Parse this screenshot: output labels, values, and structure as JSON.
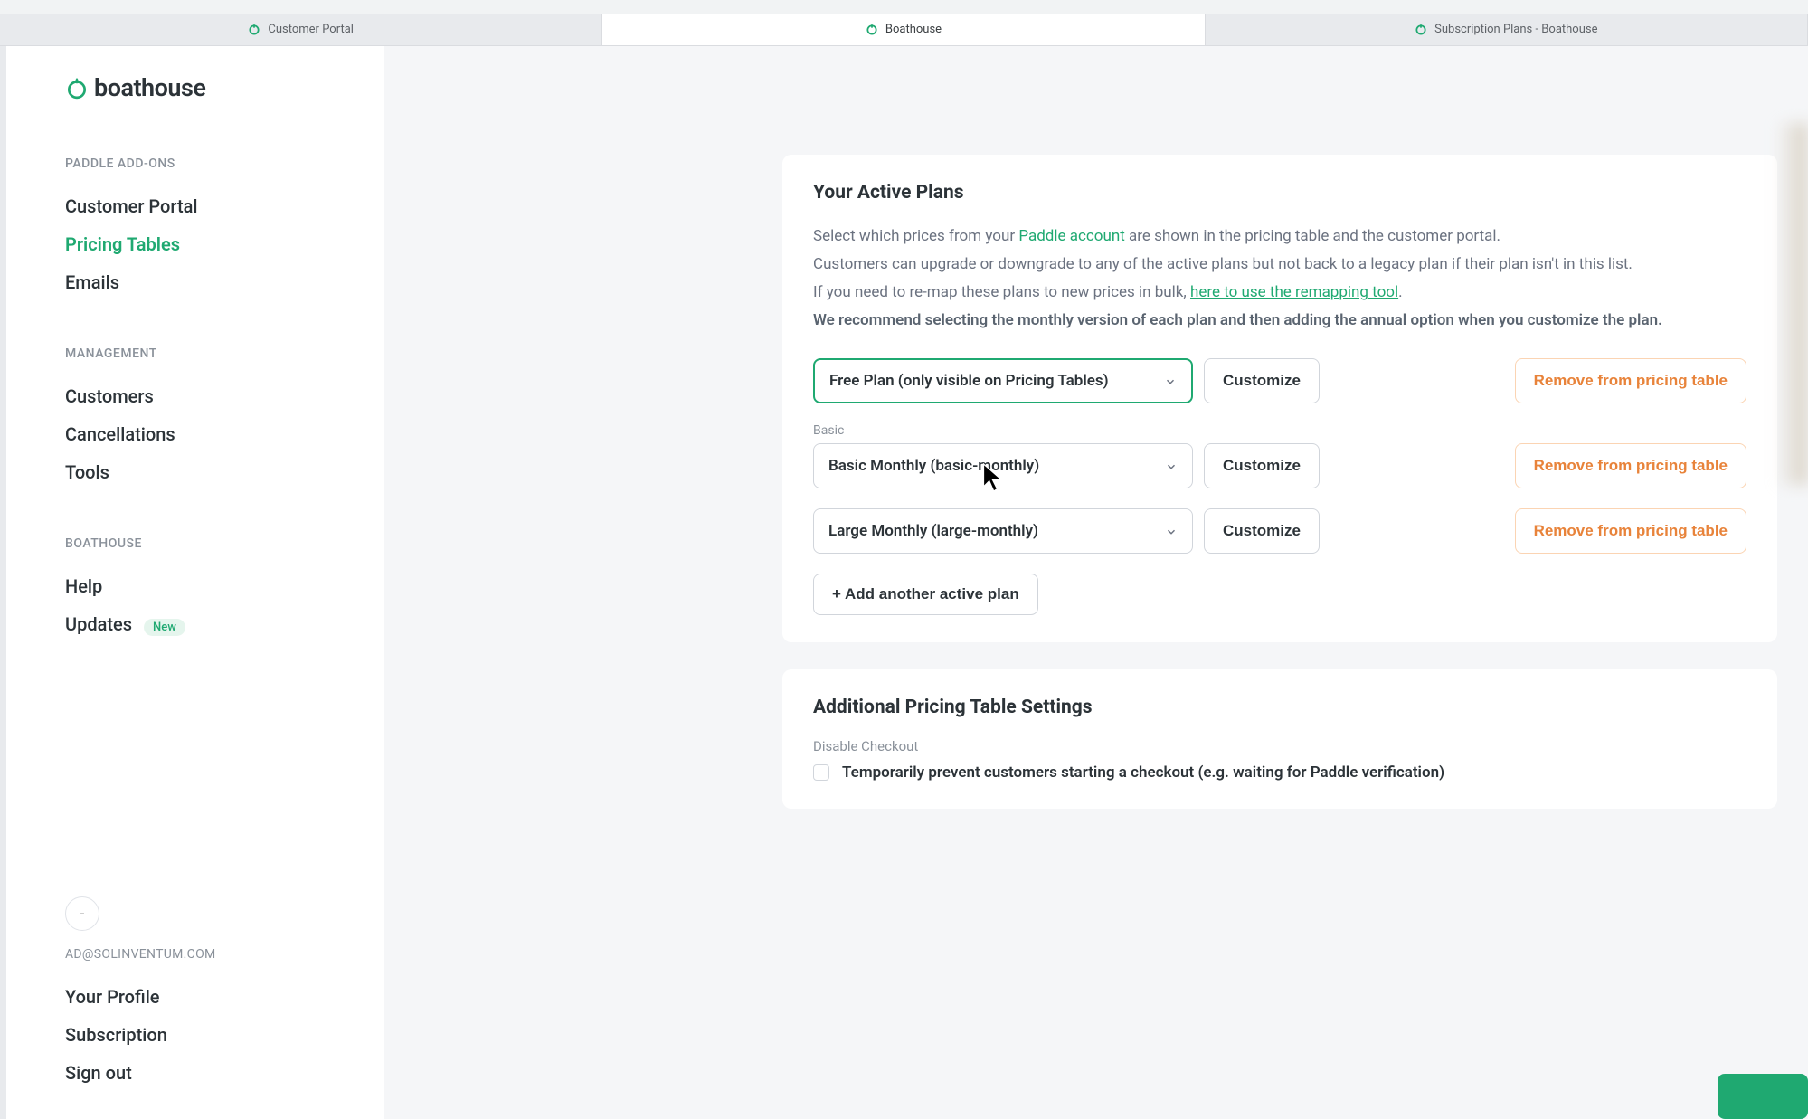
{
  "tabs": [
    {
      "label": "Customer Portal"
    },
    {
      "label": "Boathouse"
    },
    {
      "label": "Subscription Plans - Boathouse"
    }
  ],
  "brand": {
    "name": "boathouse"
  },
  "sidebar": {
    "sections": [
      {
        "heading": "PADDLE ADD-ONS",
        "items": [
          {
            "label": "Customer Portal",
            "active": false
          },
          {
            "label": "Pricing Tables",
            "active": true
          },
          {
            "label": "Emails",
            "active": false
          }
        ]
      },
      {
        "heading": "MANAGEMENT",
        "items": [
          {
            "label": "Customers"
          },
          {
            "label": "Cancellations"
          },
          {
            "label": "Tools"
          }
        ]
      },
      {
        "heading": "BOATHOUSE",
        "items": [
          {
            "label": "Help"
          },
          {
            "label": "Updates",
            "badge": "New"
          }
        ]
      }
    ],
    "user": {
      "email": "AD@SOLINVENTUM.COM",
      "profile_label": "Your Profile",
      "subscription_label": "Subscription",
      "signout_label": "Sign out"
    }
  },
  "activePlans": {
    "title": "Your Active Plans",
    "desc_line1_a": "Select which prices from your ",
    "desc_line1_link": "Paddle account",
    "desc_line1_b": " are shown in the pricing table and the customer portal.",
    "desc_line2": "Customers can upgrade or downgrade to any of the active plans but not back to a legacy plan if their plan isn't in this list.",
    "desc_line3_a": "If you need to re-map these plans to new prices in bulk, ",
    "desc_line3_link": "here to use the remapping tool",
    "desc_line3_b": ".",
    "desc_line4": "We recommend selecting the monthly version of each plan and then adding the annual option when you customize the plan.",
    "plans": [
      {
        "selected": "Free Plan (only visible on Pricing Tables)",
        "focused": true
      },
      {
        "group_label": "Basic",
        "selected": "Basic Monthly (basic-monthly)",
        "focused": false
      },
      {
        "selected": "Large Monthly (large-monthly)",
        "focused": false
      }
    ],
    "customize_label": "Customize",
    "remove_label": "Remove from pricing table",
    "add_label": "+ Add another active plan"
  },
  "additionalSettings": {
    "title": "Additional Pricing Table Settings",
    "disable_checkout_label": "Disable Checkout",
    "disable_checkout_text": "Temporarily prevent customers starting a checkout (e.g. waiting for Paddle verification)"
  }
}
